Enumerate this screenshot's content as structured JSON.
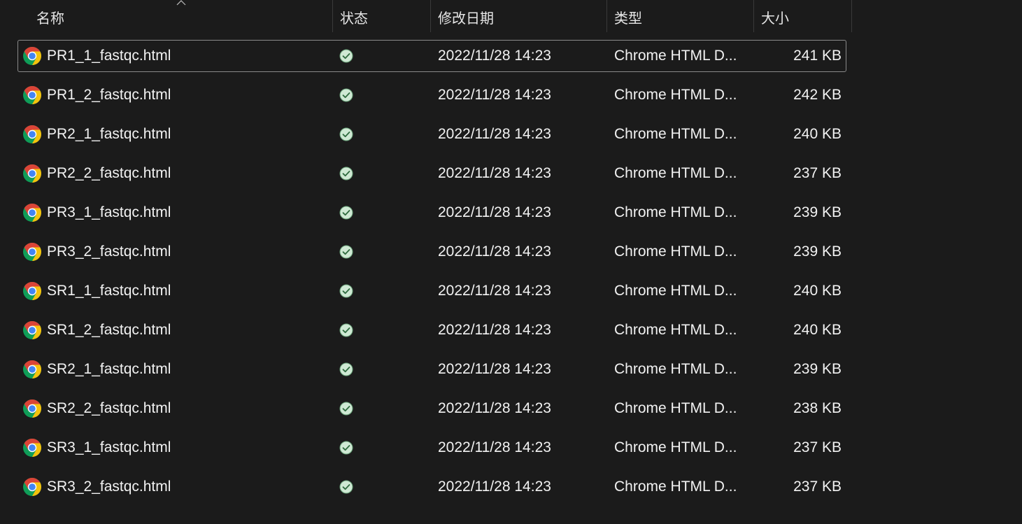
{
  "header": {
    "name": "名称",
    "status": "状态",
    "modified": "修改日期",
    "type": "类型",
    "size": "大小"
  },
  "icons": {
    "file": "chrome-icon",
    "status": "available-check-icon",
    "sort": "sort-ascending-caret-icon"
  },
  "colors": {
    "background": "#1b1b1b",
    "status_green": "#cfe9d4",
    "chrome_red": "#db4437",
    "chrome_yellow": "#f4c20d",
    "chrome_green": "#0f9d58",
    "chrome_blue": "#4285f4"
  },
  "files": [
    {
      "name": "PR1_1_fastqc.html",
      "modified": "2022/11/28 14:23",
      "type": "Chrome HTML D...",
      "size": "241 KB",
      "selected": true
    },
    {
      "name": "PR1_2_fastqc.html",
      "modified": "2022/11/28 14:23",
      "type": "Chrome HTML D...",
      "size": "242 KB"
    },
    {
      "name": "PR2_1_fastqc.html",
      "modified": "2022/11/28 14:23",
      "type": "Chrome HTML D...",
      "size": "240 KB"
    },
    {
      "name": "PR2_2_fastqc.html",
      "modified": "2022/11/28 14:23",
      "type": "Chrome HTML D...",
      "size": "237 KB"
    },
    {
      "name": "PR3_1_fastqc.html",
      "modified": "2022/11/28 14:23",
      "type": "Chrome HTML D...",
      "size": "239 KB"
    },
    {
      "name": "PR3_2_fastqc.html",
      "modified": "2022/11/28 14:23",
      "type": "Chrome HTML D...",
      "size": "239 KB"
    },
    {
      "name": "SR1_1_fastqc.html",
      "modified": "2022/11/28 14:23",
      "type": "Chrome HTML D...",
      "size": "240 KB"
    },
    {
      "name": "SR1_2_fastqc.html",
      "modified": "2022/11/28 14:23",
      "type": "Chrome HTML D...",
      "size": "240 KB"
    },
    {
      "name": "SR2_1_fastqc.html",
      "modified": "2022/11/28 14:23",
      "type": "Chrome HTML D...",
      "size": "239 KB"
    },
    {
      "name": "SR2_2_fastqc.html",
      "modified": "2022/11/28 14:23",
      "type": "Chrome HTML D...",
      "size": "238 KB"
    },
    {
      "name": "SR3_1_fastqc.html",
      "modified": "2022/11/28 14:23",
      "type": "Chrome HTML D...",
      "size": "237 KB"
    },
    {
      "name": "SR3_2_fastqc.html",
      "modified": "2022/11/28 14:23",
      "type": "Chrome HTML D...",
      "size": "237 KB"
    }
  ]
}
